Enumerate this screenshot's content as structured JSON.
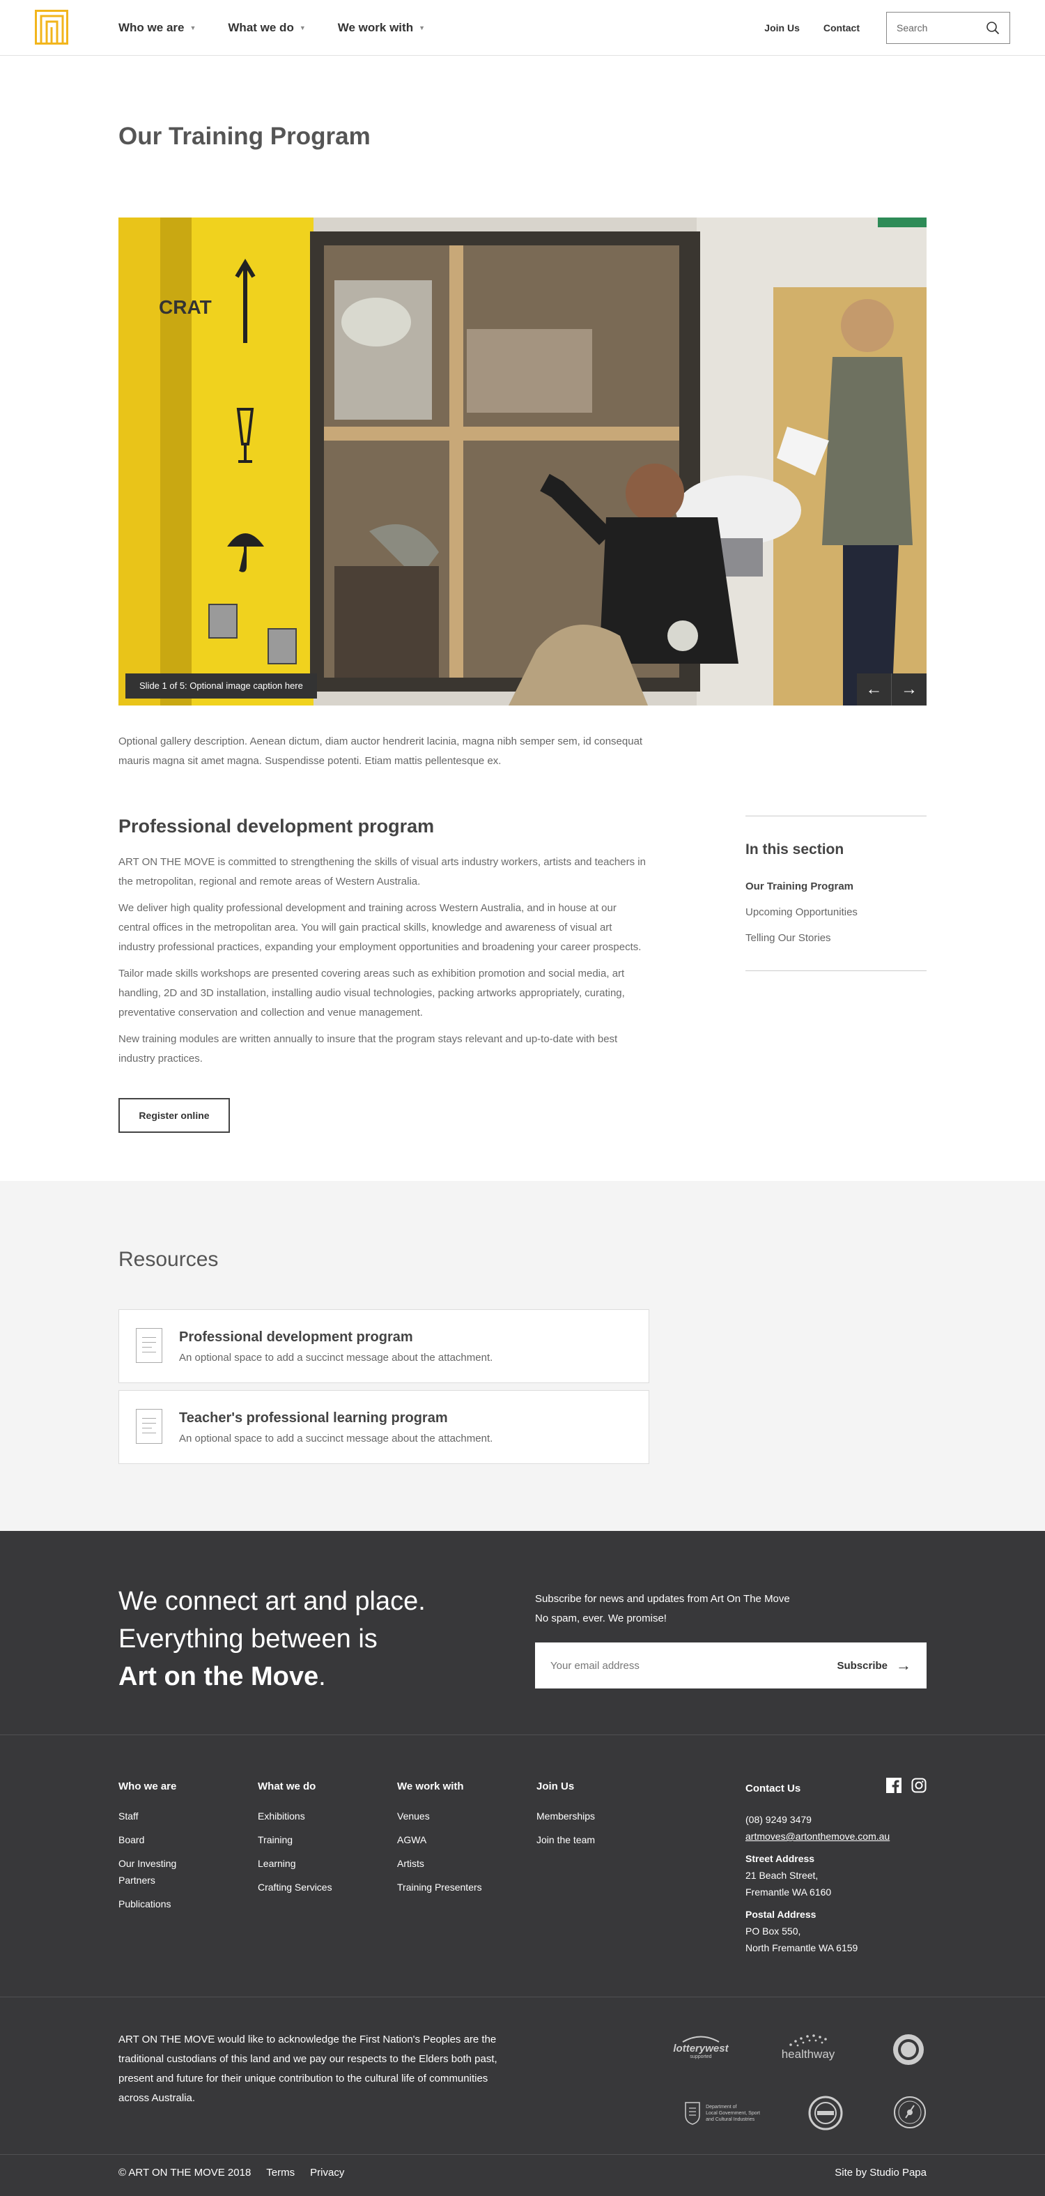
{
  "header": {
    "nav": [
      {
        "label": "Who we are"
      },
      {
        "label": "What we do"
      },
      {
        "label": "We work with"
      }
    ],
    "join_label": "Join Us",
    "contact_label": "Contact",
    "search_placeholder": "Search"
  },
  "page": {
    "title": "Our Training Program",
    "slide_caption": "Slide 1 of 5: Optional image caption here",
    "gallery_description": "Optional gallery description. Aenean dictum, diam auctor hendrerit lacinia, magna nibh semper sem, id consequat mauris magna sit amet magna. Suspendisse potenti. Etiam mattis pellentesque ex."
  },
  "content": {
    "heading": "Professional development program",
    "paragraphs": [
      "ART ON THE MOVE is committed to strengthening the skills of visual arts industry workers, artists and teachers in the metropolitan, regional and remote areas of Western Australia.",
      "We deliver high quality professional development and training across Western Australia, and in house at our central offices in the metropolitan area. You will gain practical skills, knowledge and awareness of visual art industry professional practices, expanding your employment opportunities and broadening your career prospects.",
      "Tailor made skills workshops are presented covering areas such as exhibition promotion and social media, art handling, 2D and 3D installation, installing audio visual technologies, packing artworks appropriately, curating, preventative conservation and collection and venue management.",
      "New training modules are written annually to insure that the program stays relevant and up-to-date with best industry practices."
    ],
    "register_label": "Register online"
  },
  "sidenav": {
    "heading": "In this section",
    "items": [
      {
        "label": "Our Training Program"
      },
      {
        "label": "Upcoming Opportunities"
      },
      {
        "label": "Telling Our Stories"
      }
    ]
  },
  "resources": {
    "heading": "Resources",
    "items": [
      {
        "title": "Professional development program",
        "text": "An optional space to add a succinct message about the attachment."
      },
      {
        "title": "Teacher's professional learning program",
        "text": "An optional space to add a succinct message about the attachment."
      }
    ]
  },
  "footer": {
    "tagline_1": "We connect art and place.",
    "tagline_2": "Everything between is",
    "tagline_3": "Art on the Move",
    "tagline_dot": ".",
    "subscribe_text_1": "Subscribe for news and updates from Art On The Move",
    "subscribe_text_2": "No spam, ever. We promise!",
    "email_placeholder": "Your email address",
    "subscribe_label": "Subscribe",
    "columns": [
      {
        "heading": "Who we are",
        "links": [
          "Staff",
          "Board",
          "Our Investing Partners",
          "Publications"
        ]
      },
      {
        "heading": "What we do",
        "links": [
          "Exhibitions",
          "Training",
          "Learning",
          "Crafting Services"
        ]
      },
      {
        "heading": "We work with",
        "links": [
          "Venues",
          "AGWA",
          "Artists",
          "Training Presenters"
        ]
      },
      {
        "heading": "Join Us",
        "links": [
          "Memberships",
          "Join the team"
        ]
      }
    ],
    "contact": {
      "heading": "Contact Us",
      "phone": "(08) 9249 3479",
      "email": "artmoves@artonthemove.com.au",
      "street_label": "Street Address",
      "street_1": "21 Beach Street,",
      "street_2": "Fremantle WA 6160",
      "postal_label": "Postal Address",
      "postal_1": "PO Box 550,",
      "postal_2": "North Fremantle WA 6159"
    },
    "acknowledgement": "ART ON THE MOVE would like to acknowledge the First Nation's Peoples are the traditional custodians of this land and we pay our respects to the Elders both past, present and future for their unique contribution to the cultural life of communities across Australia.",
    "partners": {
      "lotterywest": "lotterywest",
      "lotterywest_sub": "supported",
      "healthway": "healthway",
      "dlgsc_1": "Department of",
      "dlgsc_2": "Local Government, Sport",
      "dlgsc_3": "and Cultural Industries"
    },
    "copyright": "© ART ON THE MOVE 2018",
    "terms_label": "Terms",
    "privacy_label": "Privacy",
    "credit": "Site by Studio Papa"
  },
  "colors": {
    "brand_yellow": "#f2b51c",
    "footer_bg": "#38383a",
    "resources_bg": "#f4f4f4"
  }
}
